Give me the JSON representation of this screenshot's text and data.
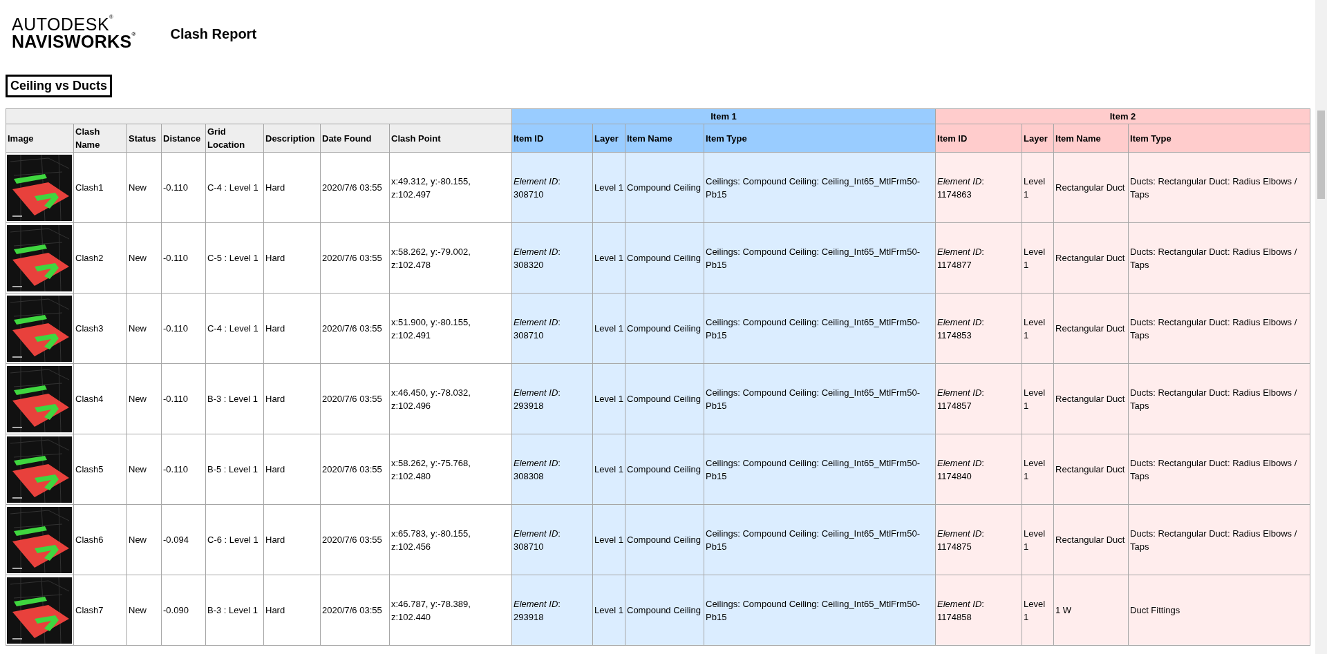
{
  "logo": {
    "line_1": "AUTODESK$^{®}$",
    "line_2": "NAVISWORKS$^{®}$"
  },
  "report_title": "Clash Report",
  "test_name": "Ceiling vs Ducts",
  "table": {
    "columns": [
      "Image",
      "Clash Name",
      "Status",
      "Distance",
      "Grid Location",
      "Description",
      "Date Found",
      "Clash Point"
    ],
    "groups": [
      {
        "label": "Item 1",
        "color": "#99ccff",
        "columns": [
          "Item ID",
          "Layer",
          "Item Name",
          "Item Type"
        ]
      },
      {
        "label": "Item 2",
        "color": "#ffcccc",
        "columns": [
          "Item ID",
          "Layer",
          "Item Name",
          "Item Type"
        ]
      }
    ],
    "rows": [
      {
        "clash_name": "Clash1",
        "status": "New",
        "distance": "-0.110",
        "grid_location": "C-4 : Level 1",
        "description": "Hard",
        "date_found": "2020/7/6 03:55",
        "clash_point": "x:49.312, y:-80.155, z:102.497",
        "items": [
          {
            "item_id": "*Element ID*: 308710",
            "layer": "Level 1",
            "item_name": "Compound Ceiling",
            "item_type": "Ceilings: Compound Ceiling: Ceiling_Int65_MtlFrm50-Pb15"
          },
          {
            "item_id": "*Element ID*: 1174863",
            "layer": "Level 1",
            "item_name": "Rectangular Duct",
            "item_type": "Ducts: Rectangular Duct: Radius Elbows / Taps"
          }
        ]
      },
      {
        "clash_name": "Clash2",
        "status": "New",
        "distance": "-0.110",
        "grid_location": "C-5 : Level 1",
        "description": "Hard",
        "date_found": "2020/7/6 03:55",
        "clash_point": "x:58.262, y:-79.002, z:102.478",
        "items": [
          {
            "item_id": "*Element ID*: 308320",
            "layer": "Level 1",
            "item_name": "Compound Ceiling",
            "item_type": "Ceilings: Compound Ceiling: Ceiling_Int65_MtlFrm50-Pb15"
          },
          {
            "item_id": "*Element ID*: 1174877",
            "layer": "Level 1",
            "item_name": "Rectangular Duct",
            "item_type": "Ducts: Rectangular Duct: Radius Elbows / Taps"
          }
        ]
      },
      {
        "clash_name": "Clash3",
        "status": "New",
        "distance": "-0.110",
        "grid_location": "C-4 : Level 1",
        "description": "Hard",
        "date_found": "2020/7/6 03:55",
        "clash_point": "x:51.900, y:-80.155, z:102.491",
        "items": [
          {
            "item_id": "*Element ID*: 308710",
            "layer": "Level 1",
            "item_name": "Compound Ceiling",
            "item_type": "Ceilings: Compound Ceiling: Ceiling_Int65_MtlFrm50-Pb15"
          },
          {
            "item_id": "*Element ID*: 1174853",
            "layer": "Level 1",
            "item_name": "Rectangular Duct",
            "item_type": "Ducts: Rectangular Duct: Radius Elbows / Taps"
          }
        ]
      },
      {
        "clash_name": "Clash4",
        "status": "New",
        "distance": "-0.110",
        "grid_location": "B-3 : Level 1",
        "description": "Hard",
        "date_found": "2020/7/6 03:55",
        "clash_point": "x:46.450, y:-78.032, z:102.496",
        "items": [
          {
            "item_id": "*Element ID*: 293918",
            "layer": "Level 1",
            "item_name": "Compound Ceiling",
            "item_type": "Ceilings: Compound Ceiling: Ceiling_Int65_MtlFrm50-Pb15"
          },
          {
            "item_id": "*Element ID*: 1174857",
            "layer": "Level 1",
            "item_name": "Rectangular Duct",
            "item_type": "Ducts: Rectangular Duct: Radius Elbows / Taps"
          }
        ]
      },
      {
        "clash_name": "Clash5",
        "status": "New",
        "distance": "-0.110",
        "grid_location": "B-5 : Level 1",
        "description": "Hard",
        "date_found": "2020/7/6 03:55",
        "clash_point": "x:58.262, y:-75.768, z:102.480",
        "items": [
          {
            "item_id": "*Element ID*: 308308",
            "layer": "Level 1",
            "item_name": "Compound Ceiling",
            "item_type": "Ceilings: Compound Ceiling: Ceiling_Int65_MtlFrm50-Pb15"
          },
          {
            "item_id": "*Element ID*: 1174840",
            "layer": "Level 1",
            "item_name": "Rectangular Duct",
            "item_type": "Ducts: Rectangular Duct: Radius Elbows / Taps"
          }
        ]
      },
      {
        "clash_name": "Clash6",
        "status": "New",
        "distance": "-0.094",
        "grid_location": "C-6 : Level 1",
        "description": "Hard",
        "date_found": "2020/7/6 03:55",
        "clash_point": "x:65.783, y:-80.155, z:102.456",
        "items": [
          {
            "item_id": "*Element ID*: 308710",
            "layer": "Level 1",
            "item_name": "Compound Ceiling",
            "item_type": "Ceilings: Compound Ceiling: Ceiling_Int65_MtlFrm50-Pb15"
          },
          {
            "item_id": "*Element ID*: 1174875",
            "layer": "Level 1",
            "item_name": "Rectangular Duct",
            "item_type": "Ducts: Rectangular Duct: Radius Elbows / Taps"
          }
        ]
      },
      {
        "clash_name": "Clash7",
        "status": "New",
        "distance": "-0.090",
        "grid_location": "B-3 : Level 1",
        "description": "Hard",
        "date_found": "2020/7/6 03:55",
        "clash_point": "x:46.787, y:-78.389, z:102.440",
        "items": [
          {
            "item_id": "*Element ID*: 293918",
            "layer": "Level 1",
            "item_name": "Compound Ceiling",
            "item_type": "Ceilings: Compound Ceiling: Ceiling_Int65_MtlFrm50-Pb15"
          },
          {
            "item_id": "*Element ID*: 1174858",
            "layer": "Level 1",
            "item_name": "1 W",
            "item_type": "Duct Fittings"
          }
        ]
      }
    ]
  }
}
